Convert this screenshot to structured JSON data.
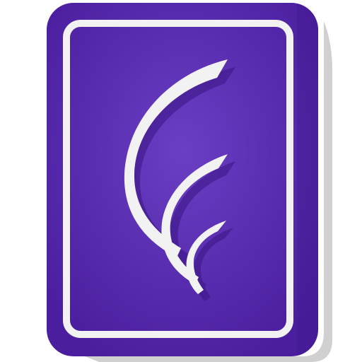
{
  "icon": {
    "name": "swoosh-card-app-icon",
    "colors": {
      "card_center": "#6a3fc4",
      "card_edge": "#4a1e9e",
      "border": "#f2f2f2",
      "swoosh": "#f2f2f2",
      "shadow": "#c8c8c8"
    }
  }
}
